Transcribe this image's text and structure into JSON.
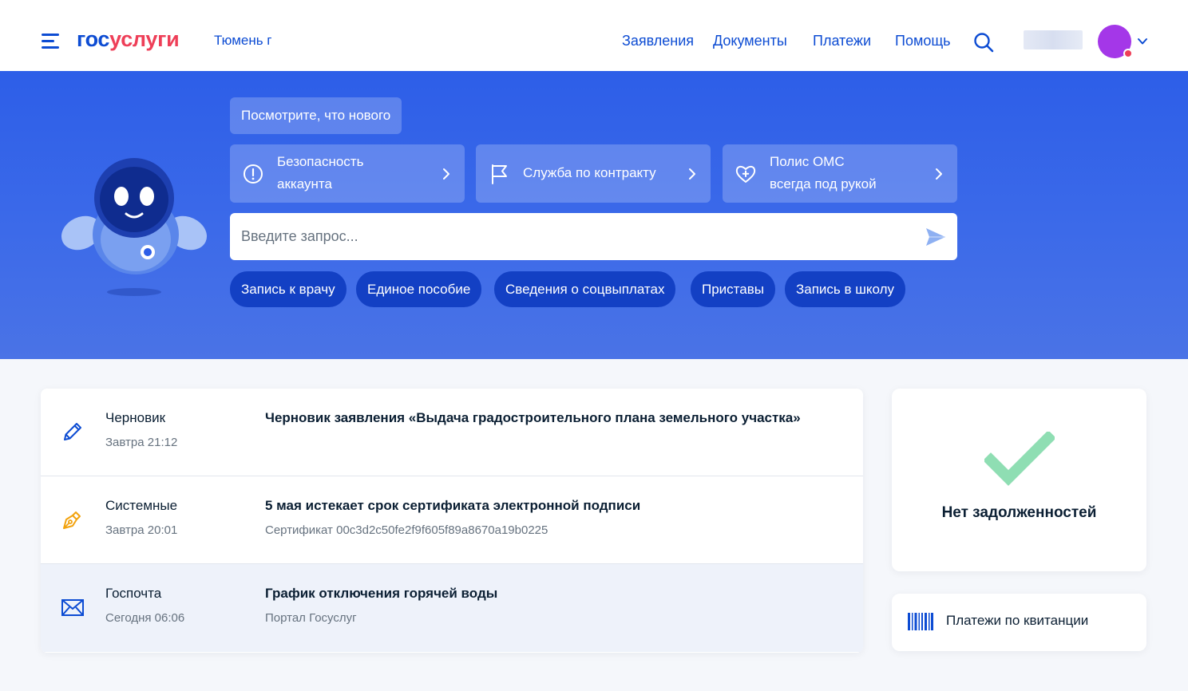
{
  "header": {
    "logo_part1": "гос",
    "logo_part2": "услуги",
    "city": "Тюмень г",
    "nav": [
      "Заявления",
      "Документы",
      "Платежи",
      "Помощь"
    ]
  },
  "hero": {
    "whats_new": "Посмотрите, что нового",
    "cards": [
      {
        "line1": "Безопасность",
        "line2": "аккаунта",
        "icon": "alert-circle-icon"
      },
      {
        "line1": "Служба по контракту",
        "icon": "flag-icon"
      },
      {
        "line1": "Полис ОМС",
        "line2": "всегда под рукой",
        "icon": "heart-plus-icon"
      }
    ],
    "search_placeholder": "Введите запрос...",
    "chips": [
      "Запись к врачу",
      "Единое пособие",
      "Сведения о соцвыплатах",
      "Приставы",
      "Запись в школу"
    ]
  },
  "feed": [
    {
      "category": "Черновик",
      "time": "Завтра 21:12",
      "title": "Черновик заявления «Выдача градостроительного плана земельного участка»",
      "icon": "pencil-icon"
    },
    {
      "category": "Системные",
      "time": "Завтра 20:01",
      "title": "5 мая истекает срок сертификата электронной подписи",
      "subtitle": "Сертификат 00c3d2c50fe2f9f605f89a8670a19b0225",
      "icon": "pen-nib-icon"
    },
    {
      "category": "Госпочта",
      "time": "Сегодня 06:06",
      "title": "График отключения горячей воды",
      "subtitle": "Портал Госуслуг",
      "icon": "envelope-icon"
    }
  ],
  "debt": {
    "label": "Нет задолженностей"
  },
  "receipt": {
    "label": "Платежи по квитанции"
  },
  "colors": {
    "brand_blue": "#0d4cd3",
    "brand_red": "#ee3f58",
    "hero_blue": "#2d5ee8",
    "chip_blue": "#1340c4",
    "success_green": "#8fdeb3",
    "avatar_purple": "#a437e8"
  }
}
